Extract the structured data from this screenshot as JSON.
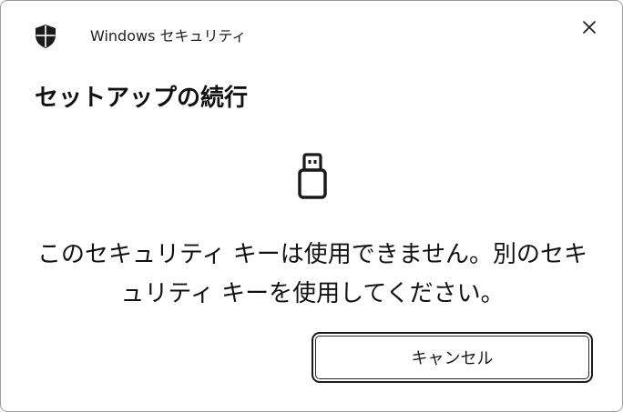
{
  "window": {
    "app_title": "Windows セキュリティ",
    "app_icon": "shield-icon",
    "close_icon": "close-icon"
  },
  "dialog": {
    "heading": "セットアップの続行",
    "device_icon": "usb-security-key-icon",
    "message": "このセキュリティ キーは使用できません。別のセキュリティ キーを使用してください。",
    "cancel_label": "キャンセル"
  },
  "colors": {
    "background": "#ffffff",
    "text": "#1a1a1a",
    "button_border": "#1b1b1b"
  }
}
